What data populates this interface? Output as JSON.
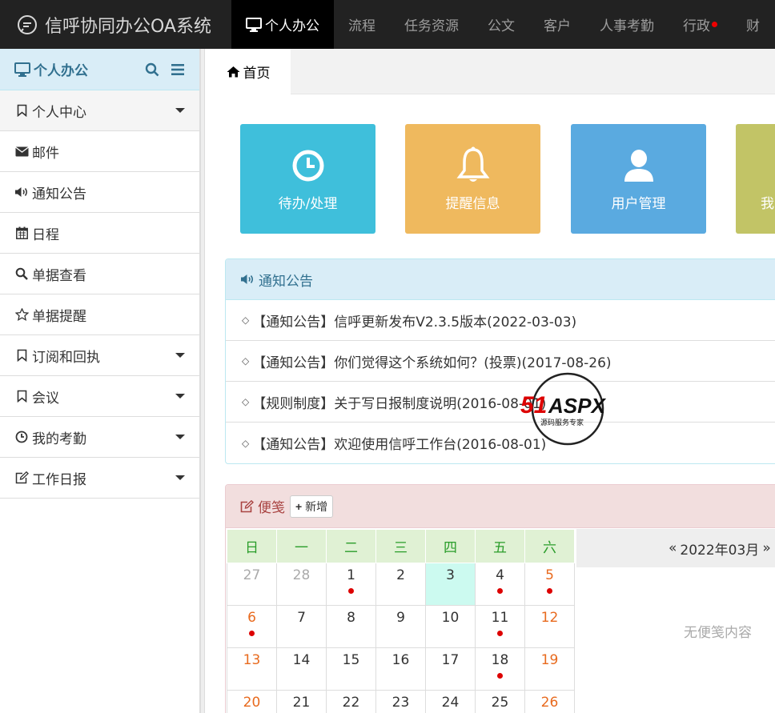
{
  "app": {
    "title": "信呼协同办公OA系统"
  },
  "topnav": [
    {
      "label": "个人办公",
      "active": true,
      "icon": "monitor-icon"
    },
    {
      "label": "流程"
    },
    {
      "label": "任务资源"
    },
    {
      "label": "公文"
    },
    {
      "label": "客户"
    },
    {
      "label": "人事考勤"
    },
    {
      "label": "行政",
      "badge": true
    },
    {
      "label": "财"
    }
  ],
  "sidebar": {
    "title": "个人办公",
    "items": [
      {
        "label": "个人中心",
        "icon": "bookmark-icon",
        "expandable": true
      },
      {
        "label": "邮件",
        "icon": "envelope-icon"
      },
      {
        "label": "通知公告",
        "icon": "volume-icon"
      },
      {
        "label": "日程",
        "icon": "calendar-icon"
      },
      {
        "label": "单据查看",
        "icon": "search-icon"
      },
      {
        "label": "单据提醒",
        "icon": "star-icon"
      },
      {
        "label": "订阅和回执",
        "icon": "bookmark-icon",
        "expandable": true
      },
      {
        "label": "会议",
        "icon": "bookmark-icon",
        "expandable": true
      },
      {
        "label": "我的考勤",
        "icon": "clock-icon",
        "expandable": true
      },
      {
        "label": "工作日报",
        "icon": "edit-icon",
        "expandable": true
      }
    ]
  },
  "tabs": {
    "home": "首页"
  },
  "tiles": [
    {
      "label": "待办/处理",
      "icon": "clock-icon",
      "color": "#3fbfdb"
    },
    {
      "label": "提醒信息",
      "icon": "bell-icon",
      "color": "#efb95e"
    },
    {
      "label": "用户管理",
      "icon": "user-icon",
      "color": "#5aaae0"
    },
    {
      "label": "我",
      "icon": "",
      "color": "#c2c466"
    }
  ],
  "notice": {
    "title": "通知公告",
    "items": [
      "【通知公告】信呼更新发布V2.3.5版本(2022-03-03)",
      "【通知公告】你们觉得这个系统如何？(投票)(2017-08-26)",
      "【规则制度】关于写日报制度说明(2016-08-01)",
      "【通知公告】欢迎使用信呼工作台(2016-08-01)"
    ]
  },
  "memo": {
    "title": "便笺",
    "add_label": "新增",
    "empty": "无便笺内容",
    "month_label": "2022年03月",
    "prev": "«",
    "next": "»"
  },
  "calendar": {
    "weekdays": [
      "日",
      "一",
      "二",
      "三",
      "四",
      "五",
      "六"
    ],
    "weeks": [
      [
        {
          "d": "27",
          "o": true
        },
        {
          "d": "28",
          "o": true
        },
        {
          "d": "1",
          "dot": true
        },
        {
          "d": "2"
        },
        {
          "d": "3",
          "today": true
        },
        {
          "d": "4",
          "dot": true
        },
        {
          "d": "5",
          "dot": true
        }
      ],
      [
        {
          "d": "6",
          "dot": true
        },
        {
          "d": "7"
        },
        {
          "d": "8"
        },
        {
          "d": "9"
        },
        {
          "d": "10"
        },
        {
          "d": "11",
          "dot": true
        },
        {
          "d": "12"
        }
      ],
      [
        {
          "d": "13"
        },
        {
          "d": "14"
        },
        {
          "d": "15"
        },
        {
          "d": "16"
        },
        {
          "d": "17"
        },
        {
          "d": "18",
          "dot": true
        },
        {
          "d": "19"
        }
      ],
      [
        {
          "d": "20"
        },
        {
          "d": "21"
        },
        {
          "d": "22"
        },
        {
          "d": "23"
        },
        {
          "d": "24"
        },
        {
          "d": "25"
        },
        {
          "d": "26"
        }
      ]
    ]
  },
  "watermark": {
    "brand": "51ASPX",
    "tagline": "源码服务专家"
  },
  "colors": {
    "topbar": "#222222",
    "panel_info": "#d9edf7",
    "panel_danger": "#f2dede",
    "weekend": "#e86a1e",
    "today": "#ccfaf0"
  }
}
